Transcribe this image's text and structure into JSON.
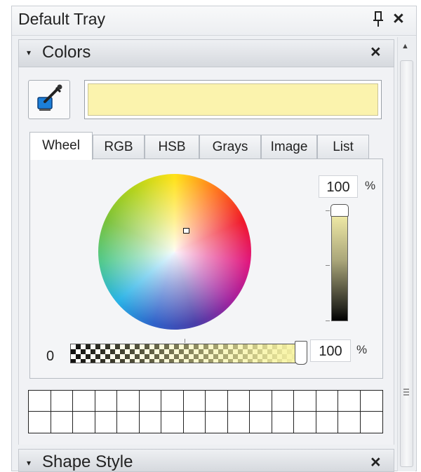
{
  "tray": {
    "title": "Default Tray",
    "pin_icon": "pin-icon",
    "close_label": "×"
  },
  "colors_docker": {
    "toggle_icon": "▾",
    "title": "Colors",
    "close_label": "×",
    "eyedropper_icon": "eyedropper-icon",
    "current_color": "#fbf3ad",
    "tabs": [
      {
        "label": "Wheel",
        "active": true
      },
      {
        "label": "RGB",
        "active": false
      },
      {
        "label": "HSB",
        "active": false
      },
      {
        "label": "Grays",
        "active": false
      },
      {
        "label": "Image",
        "active": false
      },
      {
        "label": "List",
        "active": false
      }
    ],
    "wheel": {
      "brightness_value": "100",
      "brightness_unit": "%",
      "opacity_min_label": "0",
      "opacity_value": "100",
      "opacity_unit": "%"
    },
    "palette": {
      "rows": 2,
      "columns": 16
    }
  },
  "shape_style_docker": {
    "toggle_icon": "▾",
    "title": "Shape Style",
    "close_label": "×"
  }
}
